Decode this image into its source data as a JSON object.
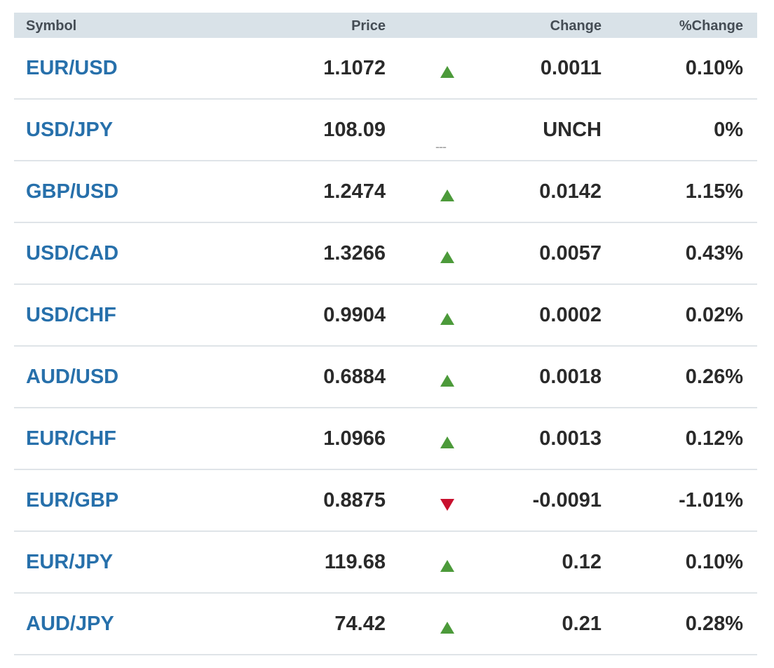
{
  "table": {
    "headers": {
      "symbol": "Symbol",
      "price": "Price",
      "change": "Change",
      "pct_change": "%Change"
    },
    "colors": {
      "header_bg": "#d9e2e8",
      "symbol_link": "#2770ab",
      "up": "#4c9a3a",
      "down": "#c8102e",
      "unchanged": "#9a9a9a"
    },
    "rows": [
      {
        "symbol": "EUR/USD",
        "price": "1.1072",
        "direction": "up",
        "change": "0.0011",
        "pct_change": "0.10%"
      },
      {
        "symbol": "USD/JPY",
        "price": "108.09",
        "direction": "unchanged",
        "unch_marker": "---",
        "change": "UNCH",
        "pct_change": "0%"
      },
      {
        "symbol": "GBP/USD",
        "price": "1.2474",
        "direction": "up",
        "change": "0.0142",
        "pct_change": "1.15%"
      },
      {
        "symbol": "USD/CAD",
        "price": "1.3266",
        "direction": "up",
        "change": "0.0057",
        "pct_change": "0.43%"
      },
      {
        "symbol": "USD/CHF",
        "price": "0.9904",
        "direction": "up",
        "change": "0.0002",
        "pct_change": "0.02%"
      },
      {
        "symbol": "AUD/USD",
        "price": "0.6884",
        "direction": "up",
        "change": "0.0018",
        "pct_change": "0.26%"
      },
      {
        "symbol": "EUR/CHF",
        "price": "1.0966",
        "direction": "up",
        "change": "0.0013",
        "pct_change": "0.12%"
      },
      {
        "symbol": "EUR/GBP",
        "price": "0.8875",
        "direction": "down",
        "change": "-0.0091",
        "pct_change": "-1.01%"
      },
      {
        "symbol": "EUR/JPY",
        "price": "119.68",
        "direction": "up",
        "change": "0.12",
        "pct_change": "0.10%"
      },
      {
        "symbol": "AUD/JPY",
        "price": "74.42",
        "direction": "up",
        "change": "0.21",
        "pct_change": "0.28%"
      }
    ]
  }
}
